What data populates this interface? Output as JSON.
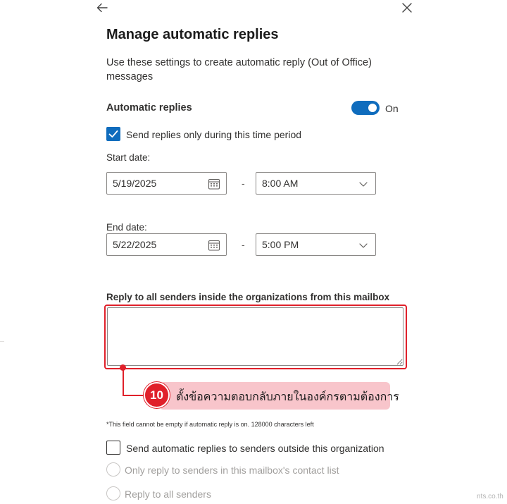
{
  "panel": {
    "title": "Manage automatic replies",
    "description": "Use these settings to create automatic reply (Out of Office) messages",
    "back_icon": "arrow-left-icon",
    "close_icon": "close-icon"
  },
  "automatic_replies": {
    "label": "Automatic replies",
    "toggle_state": "On",
    "toggle_on": true
  },
  "time_period": {
    "checkbox_label": "Send replies only during this time period",
    "checked": true
  },
  "start": {
    "label": "Start date:",
    "date": "5/19/2025",
    "time": "8:00 AM"
  },
  "end": {
    "label": "End date:",
    "date": "5/22/2025",
    "time": "5:00 PM"
  },
  "separator": "-",
  "inside_reply": {
    "label": "Reply to all senders inside the organizations from this mailbox",
    "value": ""
  },
  "annotation": {
    "step_number": "10",
    "text": "ตั้งข้อความตอบกลับภายในองค์กรตามต้องการ"
  },
  "hint": "*This field cannot be empty if automatic reply is on. 128000 characters left",
  "outside": {
    "checkbox_label": "Send automatic replies to senders outside this organization",
    "checked": false,
    "options": [
      "Only reply to senders in this mailbox's contact list",
      "Reply to all senders"
    ]
  },
  "watermark": "nts.co.th",
  "colors": {
    "accent": "#0f6cbd",
    "highlight_red": "#e0202a",
    "callout_pink": "#f8c5cb"
  }
}
